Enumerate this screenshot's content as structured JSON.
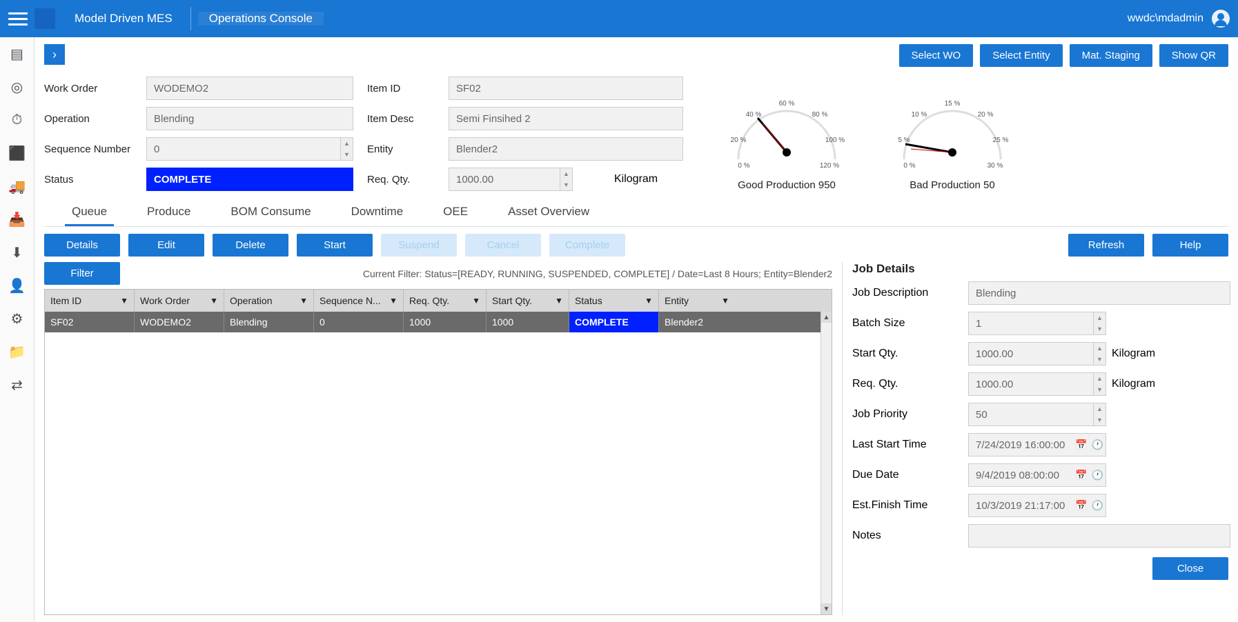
{
  "top": {
    "app_title": "Model Driven MES",
    "console": "Operations Console",
    "user": "wwdc\\mdadmin"
  },
  "header_buttons": {
    "select_wo": "Select WO",
    "select_entity": "Select Entity",
    "mat_staging": "Mat. Staging",
    "show_qr": "Show QR"
  },
  "form": {
    "work_order_label": "Work Order",
    "work_order": "WODEMO2",
    "operation_label": "Operation",
    "operation": "Blending",
    "seq_label": "Sequence Number",
    "seq": "0",
    "status_label": "Status",
    "status": "COMPLETE",
    "item_id_label": "Item ID",
    "item_id": "SF02",
    "item_desc_label": "Item Desc",
    "item_desc": "Semi Finsihed 2",
    "entity_label": "Entity",
    "entity": "Blender2",
    "req_qty_label": "Req. Qty.",
    "req_qty": "1000.00",
    "unit": "Kilogram"
  },
  "gauges": {
    "good_label": "Good Production 950",
    "bad_label": "Bad Production 50"
  },
  "tabs": {
    "queue": "Queue",
    "produce": "Produce",
    "bom": "BOM Consume",
    "downtime": "Downtime",
    "oee": "OEE",
    "asset": "Asset Overview"
  },
  "actions": {
    "details": "Details",
    "edit": "Edit",
    "delete": "Delete",
    "start": "Start",
    "suspend": "Suspend",
    "cancel": "Cancel",
    "complete": "Complete",
    "refresh": "Refresh",
    "help": "Help",
    "filter": "Filter"
  },
  "filter_text": "Current Filter: Status=[READY, RUNNING, SUSPENDED, COMPLETE] / Date=Last 8 Hours; Entity=Blender2",
  "grid": {
    "headers": {
      "item_id": "Item ID",
      "work_order": "Work Order",
      "operation": "Operation",
      "seq": "Sequence N...",
      "req_qty": "Req. Qty.",
      "start_qty": "Start Qty.",
      "status": "Status",
      "entity": "Entity"
    },
    "row": {
      "item_id": "SF02",
      "work_order": "WODEMO2",
      "operation": "Blending",
      "seq": "0",
      "req_qty": "1000",
      "start_qty": "1000",
      "status": "COMPLETE",
      "entity": "Blender2"
    }
  },
  "details": {
    "title": "Job Details",
    "job_desc_label": "Job Description",
    "job_desc": "Blending",
    "batch_label": "Batch Size",
    "batch": "1",
    "start_qty_label": "Start Qty.",
    "start_qty": "1000.00",
    "start_qty_unit": "Kilogram",
    "req_qty_label": "Req. Qty.",
    "req_qty": "1000.00",
    "req_qty_unit": "Kilogram",
    "priority_label": "Job Priority",
    "priority": "50",
    "last_start_label": "Last Start Time",
    "last_start": "7/24/2019 16:00:00",
    "due_label": "Due Date",
    "due": "9/4/2019 08:00:00",
    "est_finish_label": "Est.Finish Time",
    "est_finish": "10/3/2019 21:17:00",
    "notes_label": "Notes",
    "notes": "",
    "close": "Close"
  },
  "chart_data": [
    {
      "type": "gauge",
      "title": "Good Production 950",
      "value": 45,
      "ticks": [
        {
          "label": "0 %",
          "value": 0
        },
        {
          "label": "20 %",
          "value": 20
        },
        {
          "label": "40 %",
          "value": 40
        },
        {
          "label": "60 %",
          "value": 60
        },
        {
          "label": "80 %",
          "value": 80
        },
        {
          "label": "100 %",
          "value": 100
        },
        {
          "label": "120 %",
          "value": 120
        }
      ],
      "range": [
        0,
        120
      ]
    },
    {
      "type": "gauge",
      "title": "Bad Production 50",
      "value": 5,
      "ticks": [
        {
          "label": "0 %",
          "value": 0
        },
        {
          "label": "5 %",
          "value": 5
        },
        {
          "label": "10 %",
          "value": 10
        },
        {
          "label": "15 %",
          "value": 15
        },
        {
          "label": "20 %",
          "value": 20
        },
        {
          "label": "25 %",
          "value": 25
        },
        {
          "label": "30 %",
          "value": 30
        }
      ],
      "range": [
        0,
        30
      ]
    }
  ]
}
